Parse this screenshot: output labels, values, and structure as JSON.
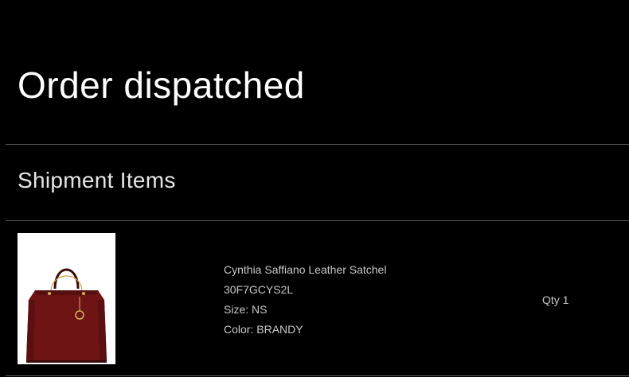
{
  "header": {
    "title": "Order dispatched"
  },
  "shipment": {
    "section_title": "Shipment Items",
    "items": [
      {
        "name": "Cynthia Saffiano Leather Satchel",
        "sku": "30F7GCYS2L",
        "size_label": "Size:",
        "size_value": "NS",
        "color_label": "Color:",
        "color_value": "BRANDY",
        "qty_label": "Qty",
        "qty_value": "1",
        "image_icon": "handbag-image"
      }
    ]
  },
  "colors": {
    "background": "#000000",
    "divider": "#5a5a5a",
    "bag": "#6e1414"
  }
}
